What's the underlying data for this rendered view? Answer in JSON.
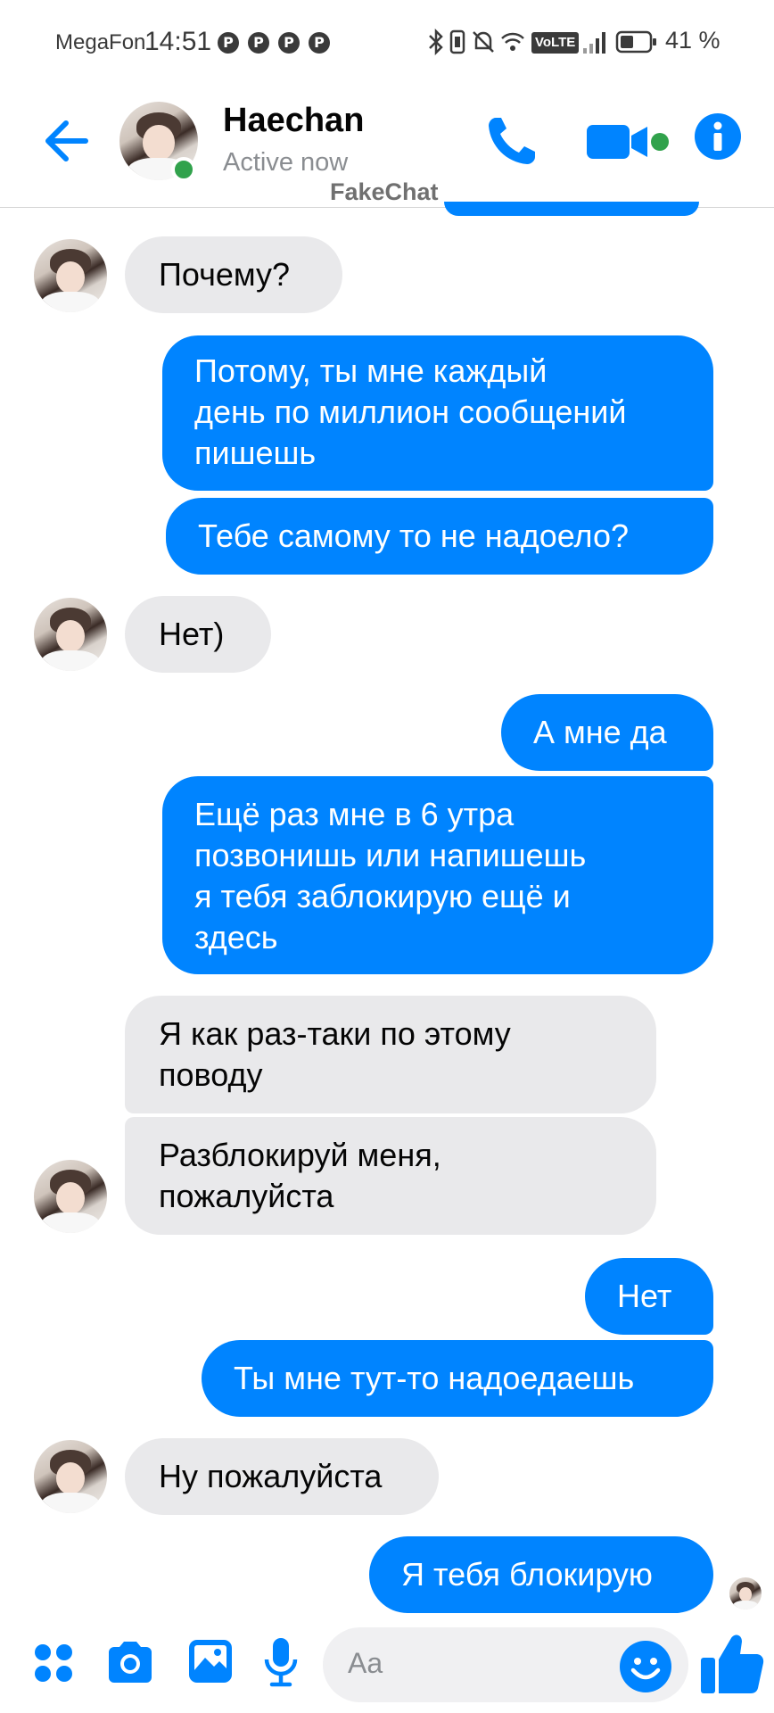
{
  "status_bar": {
    "carrier": "MegaFon",
    "time": "14:51",
    "network": "VoLTE",
    "battery": "41 %"
  },
  "header": {
    "contact_name": "Haechan",
    "status": "Active now",
    "watermark": "FakeChat"
  },
  "messages": [
    {
      "from": "them",
      "text": "Почему?"
    },
    {
      "from": "me",
      "lines": [
        "Потому, ты мне каждый",
        "день по миллион сообщений",
        "пишешь"
      ]
    },
    {
      "from": "me",
      "text": "Тебе самому то не надоело?"
    },
    {
      "from": "them",
      "text": "Нет)"
    },
    {
      "from": "me",
      "text": "А мне да"
    },
    {
      "from": "me",
      "lines": [
        "Ещё раз мне в 6 утра",
        "позвонишь или напишешь",
        "я тебя заблокирую ещё и",
        "здесь"
      ]
    },
    {
      "from": "them",
      "lines": [
        "Я как раз-таки по этому",
        "поводу"
      ]
    },
    {
      "from": "them",
      "lines": [
        "Разблокируй меня,",
        "пожалуйста"
      ]
    },
    {
      "from": "me",
      "text": "Нет"
    },
    {
      "from": "me",
      "text": "Ты мне тут-то надоедаешь"
    },
    {
      "from": "them",
      "text": "Ну пожалуйста"
    },
    {
      "from": "me",
      "text": "Я тебя блокирую"
    }
  ],
  "composer": {
    "placeholder": "Aa"
  },
  "colors": {
    "accent": "#0084ff",
    "incoming_bubble": "#e9e9eb",
    "online": "#31a24c"
  }
}
